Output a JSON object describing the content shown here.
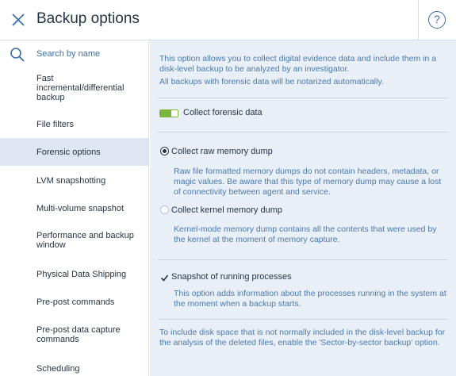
{
  "header": {
    "title": "Backup options",
    "help_glyph": "?"
  },
  "sidebar": {
    "search_placeholder": "Search by name",
    "items": [
      {
        "label": "Fast incremental/differential backup",
        "active": false
      },
      {
        "label": "File filters",
        "active": false
      },
      {
        "label": "Forensic options",
        "active": true
      },
      {
        "label": "LVM snapshotting",
        "active": false
      },
      {
        "label": "Multi-volume snapshot",
        "active": false
      },
      {
        "label": "Performance and backup window",
        "active": false
      },
      {
        "label": "Physical Data Shipping",
        "active": false
      },
      {
        "label": "Pre-post commands",
        "active": false
      },
      {
        "label": "Pre-post data capture commands",
        "active": false
      },
      {
        "label": "Scheduling",
        "active": false
      }
    ]
  },
  "main": {
    "intro": "This option allows you to collect digital evidence data and include them in a disk-level backup to be analyzed by an investigator.",
    "notarize_note": "All backups with forensic data will be notarized automatically.",
    "collect_toggle": {
      "label": "Collect forensic data",
      "on": true
    },
    "raw_dump": {
      "label": "Collect raw memory dump",
      "selected": true,
      "description": "Raw file formatted memory dumps do not contain headers, metadata, or magic values. Be aware that this type of memory dump may cause a lost of connectivity between agent and service."
    },
    "kernel_dump": {
      "label": "Collect kernel memory dump",
      "selected": false,
      "description": "Kernel-mode memory dump contains all the contents that were used by the kernel at the moment of memory capture."
    },
    "snapshot": {
      "label": "Snapshot of running processes",
      "checked": true,
      "description": "This option adds information about the processes running in the system at the moment when a backup starts."
    },
    "footer_note": "To include disk space that is not normally included in the disk-level backup for the analysis of the deleted files, enable the 'Sector-by-sector backup' option."
  },
  "colors": {
    "accent": "#3a6ea5",
    "toggle_on": "#7cb53d",
    "panel_bg": "#e9eff7",
    "active_item_bg": "#dde6f1"
  }
}
